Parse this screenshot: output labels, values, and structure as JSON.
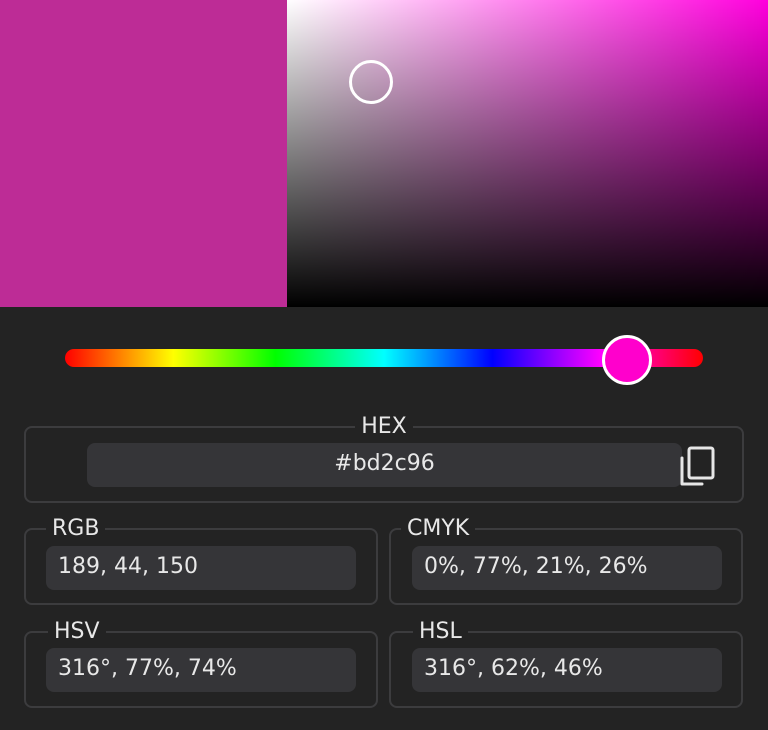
{
  "colors": {
    "selected": "#bd2c96",
    "hue_pure": "#ff00dd",
    "hue_handle": "#ff00cc"
  },
  "picker": {
    "saturation": 0.77,
    "value": 0.74,
    "hue_degrees": 316
  },
  "hex": {
    "label": "HEX",
    "value": "#bd2c96",
    "copy_icon": "copy-icon"
  },
  "rgb": {
    "label": "RGB",
    "value": "189, 44, 150"
  },
  "cmyk": {
    "label": "CMYK",
    "value": "0%, 77%, 21%, 26%"
  },
  "hsv": {
    "label": "HSV",
    "value": "316°, 77%, 74%"
  },
  "hsl": {
    "label": "HSL",
    "value": "316°, 62%, 46%"
  }
}
